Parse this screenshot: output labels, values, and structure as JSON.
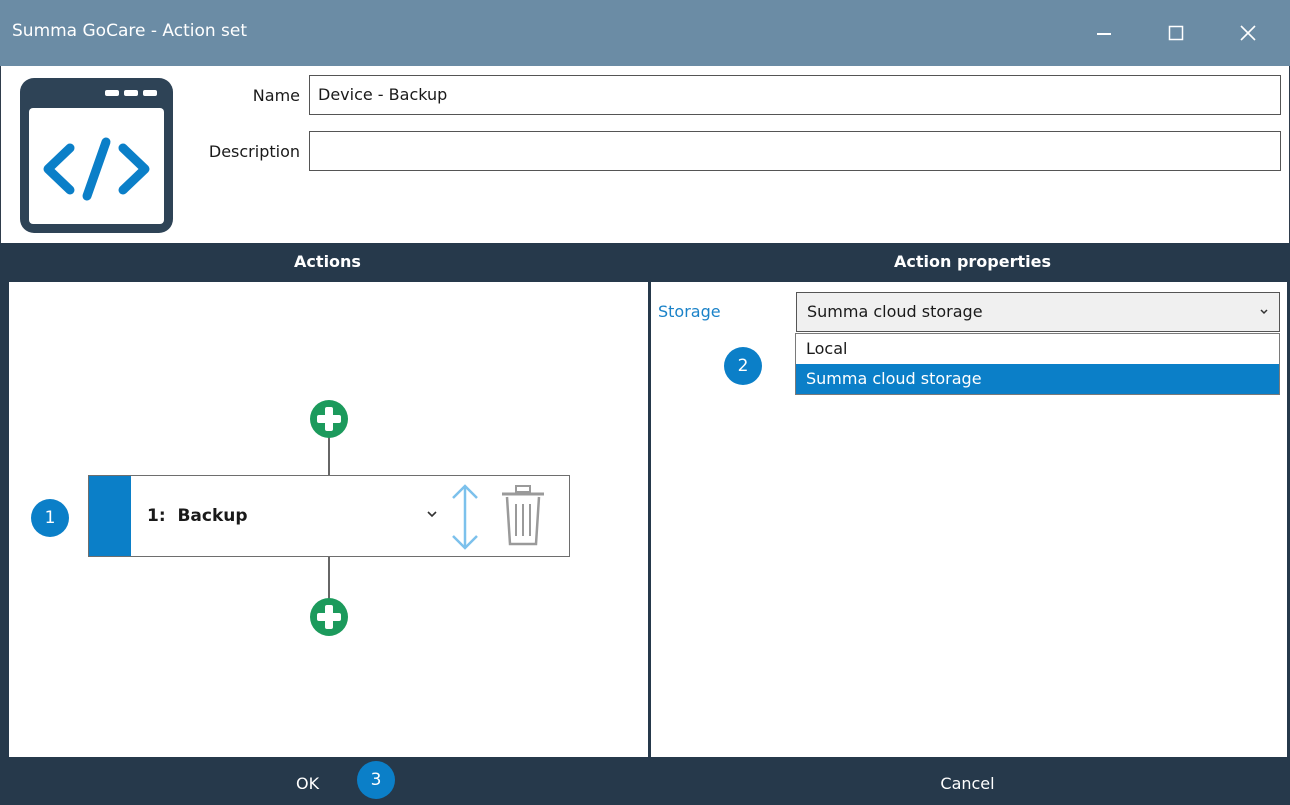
{
  "window": {
    "title": "Summa GoCare - Action set",
    "titlebar_color": "#6b8ca5",
    "dark_color": "#26394b",
    "accent_color": "#0b7fc8",
    "add_color": "#1c9a5c"
  },
  "header": {
    "icon": "code-window-icon",
    "name_label": "Name",
    "name_value": "Device - Backup",
    "description_label": "Description",
    "description_value": ""
  },
  "actions_panel": {
    "title": "Actions",
    "badge": "1",
    "items": [
      {
        "label": "1:  Backup"
      }
    ]
  },
  "properties_panel": {
    "title": "Action properties",
    "storage_label": "Storage",
    "storage_selected": "Summa cloud storage",
    "badge": "2",
    "storage_options": [
      "Local",
      "Summa cloud storage"
    ]
  },
  "footer": {
    "ok_label": "OK",
    "ok_badge": "3",
    "cancel_label": "Cancel"
  }
}
